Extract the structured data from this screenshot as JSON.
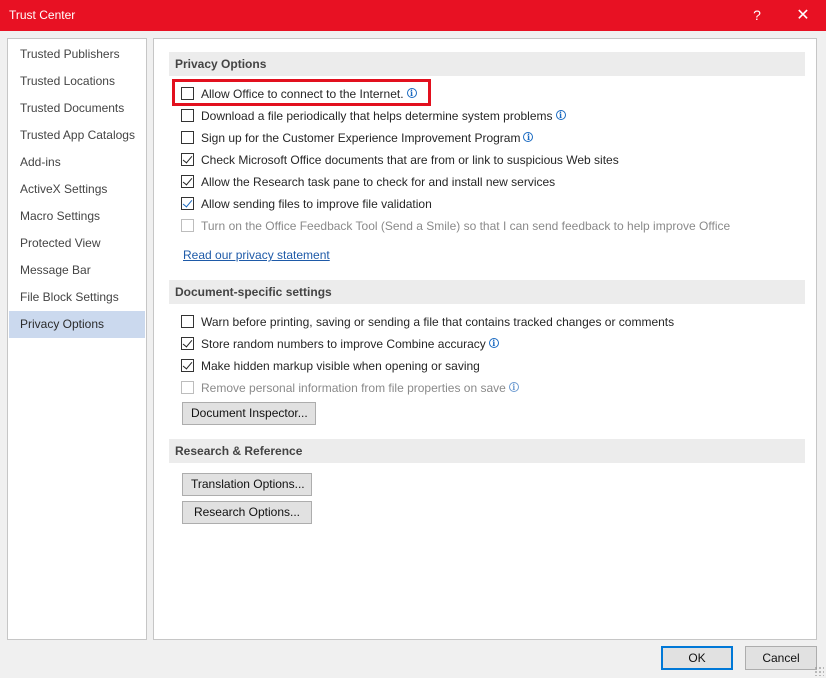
{
  "window": {
    "title": "Trust Center",
    "help_glyph": "?",
    "close_glyph": "✕"
  },
  "sidebar": {
    "items": [
      {
        "label": "Trusted Publishers"
      },
      {
        "label": "Trusted Locations"
      },
      {
        "label": "Trusted Documents"
      },
      {
        "label": "Trusted App Catalogs"
      },
      {
        "label": "Add-ins"
      },
      {
        "label": "ActiveX Settings"
      },
      {
        "label": "Macro Settings"
      },
      {
        "label": "Protected View"
      },
      {
        "label": "Message Bar"
      },
      {
        "label": "File Block Settings"
      },
      {
        "label": "Privacy Options"
      }
    ],
    "selected": "Privacy Options"
  },
  "privacy": {
    "header": "Privacy Options",
    "options": [
      {
        "label": "Allow Office to connect to the Internet.",
        "checked": false,
        "enabled": true,
        "info": true
      },
      {
        "label": "Download a file periodically that helps determine system problems",
        "checked": false,
        "enabled": true,
        "info": true
      },
      {
        "label": "Sign up for the Customer Experience Improvement Program",
        "checked": false,
        "enabled": true,
        "info": true
      },
      {
        "label": "Check Microsoft Office documents that are from or link to suspicious Web sites",
        "checked": true,
        "enabled": true,
        "info": false
      },
      {
        "label": "Allow the Research task pane to check for and install new services",
        "checked": true,
        "enabled": true,
        "info": false
      },
      {
        "label": "Allow sending files to improve file validation",
        "checked": true,
        "enabled": true,
        "info": false
      },
      {
        "label": "Turn on the Office Feedback Tool (Send a Smile) so that I can send feedback to help improve Office",
        "checked": false,
        "enabled": false,
        "info": false
      }
    ],
    "link": "Read our privacy statement"
  },
  "document": {
    "header": "Document-specific settings",
    "options": [
      {
        "label": "Warn before printing, saving or sending a file that contains tracked changes or comments",
        "checked": false,
        "enabled": true,
        "info": false
      },
      {
        "label": "Store random numbers to improve Combine accuracy",
        "checked": true,
        "enabled": true,
        "info": true
      },
      {
        "label": "Make hidden markup visible when opening or saving",
        "checked": true,
        "enabled": true,
        "info": false
      },
      {
        "label": "Remove personal information from file properties on save",
        "checked": false,
        "enabled": false,
        "info": true
      }
    ],
    "inspector_button": "Document Inspector..."
  },
  "research": {
    "header": "Research & Reference",
    "translation_button": "Translation Options...",
    "research_button": "Research Options..."
  },
  "footer": {
    "ok": "OK",
    "cancel": "Cancel"
  },
  "colors": {
    "titlebar": "#e81123",
    "highlight": "#e2101e",
    "selected_nav": "#cbd9ee",
    "link": "#1e5aa8"
  },
  "icons": {
    "info": "info-icon",
    "close": "close-icon",
    "help": "help-icon"
  }
}
